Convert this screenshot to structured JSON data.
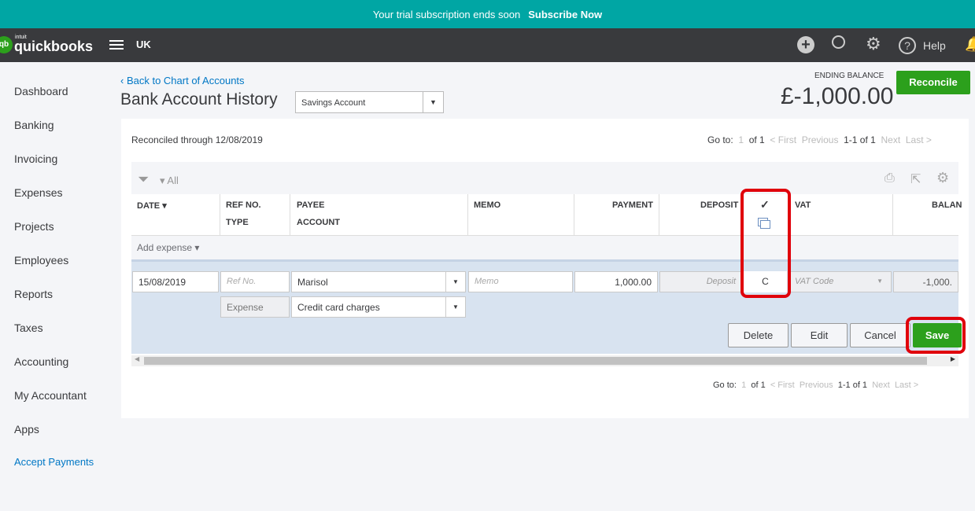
{
  "banner": {
    "text": "Your trial subscription ends soon",
    "link": "Subscribe Now"
  },
  "topbar": {
    "logo_small": "intuit",
    "logo": "quickbooks",
    "region": "UK",
    "help": "Help"
  },
  "sidebar": {
    "items": [
      "Dashboard",
      "Banking",
      "Invoicing",
      "Expenses",
      "Projects",
      "Employees",
      "Reports",
      "Taxes",
      "Accounting",
      "My Accountant",
      "Apps"
    ],
    "accept_payments": "Accept Payments"
  },
  "header": {
    "back_link": "Back to Chart of Accounts",
    "title": "Bank Account History",
    "account": "Savings Account",
    "ending_balance_label": "ENDING BALANCE",
    "ending_balance": "£-1,000.00",
    "reconcile": "Reconcile"
  },
  "reconciled_text": "Reconciled through 12/08/2019",
  "pagination": {
    "goto": "Go to:",
    "page": "1",
    "of": "of 1",
    "first": "< First",
    "previous": "Previous",
    "range": "1-1 of 1",
    "next": "Next",
    "last": "Last >"
  },
  "filter": {
    "label": "All"
  },
  "columns": {
    "date": "DATE",
    "ref": "REF NO.",
    "type": "TYPE",
    "payee": "PAYEE",
    "account": "ACCOUNT",
    "memo": "MEMO",
    "payment": "PAYMENT",
    "deposit": "DEPOSIT",
    "check": "✓",
    "vat": "VAT",
    "balance": "BALAN"
  },
  "add_expense": "Add expense",
  "row": {
    "date": "15/08/2019",
    "ref_placeholder": "Ref No.",
    "payee": "Marisol",
    "memo_placeholder": "Memo",
    "payment": "1,000.00",
    "deposit_placeholder": "Deposit",
    "cleared": "C",
    "vat_placeholder": "VAT Code",
    "balance": "-1,000.",
    "type": "Expense",
    "account": "Credit card charges"
  },
  "actions": {
    "delete": "Delete",
    "edit": "Edit",
    "cancel": "Cancel",
    "save": "Save"
  },
  "colors": {
    "teal": "#00a6a4",
    "green": "#2ca01c",
    "highlight": "#e0000b"
  }
}
